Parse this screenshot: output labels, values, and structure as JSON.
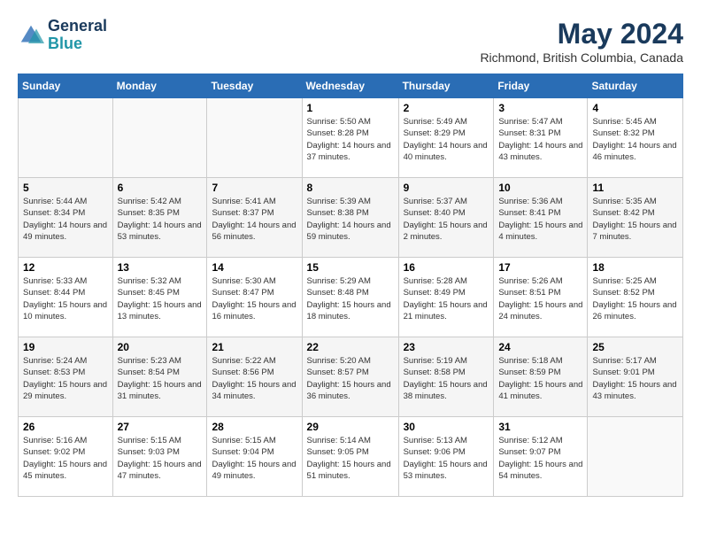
{
  "header": {
    "logo_line1": "General",
    "logo_line2": "Blue",
    "month": "May 2024",
    "location": "Richmond, British Columbia, Canada"
  },
  "days_of_week": [
    "Sunday",
    "Monday",
    "Tuesday",
    "Wednesday",
    "Thursday",
    "Friday",
    "Saturday"
  ],
  "weeks": [
    {
      "days": [
        {
          "num": "",
          "empty": true
        },
        {
          "num": "",
          "empty": true
        },
        {
          "num": "",
          "empty": true
        },
        {
          "num": "1",
          "sunrise": "5:50 AM",
          "sunset": "8:28 PM",
          "daylight": "14 hours and 37 minutes."
        },
        {
          "num": "2",
          "sunrise": "5:49 AM",
          "sunset": "8:29 PM",
          "daylight": "14 hours and 40 minutes."
        },
        {
          "num": "3",
          "sunrise": "5:47 AM",
          "sunset": "8:31 PM",
          "daylight": "14 hours and 43 minutes."
        },
        {
          "num": "4",
          "sunrise": "5:45 AM",
          "sunset": "8:32 PM",
          "daylight": "14 hours and 46 minutes."
        }
      ]
    },
    {
      "days": [
        {
          "num": "5",
          "sunrise": "5:44 AM",
          "sunset": "8:34 PM",
          "daylight": "14 hours and 49 minutes."
        },
        {
          "num": "6",
          "sunrise": "5:42 AM",
          "sunset": "8:35 PM",
          "daylight": "14 hours and 53 minutes."
        },
        {
          "num": "7",
          "sunrise": "5:41 AM",
          "sunset": "8:37 PM",
          "daylight": "14 hours and 56 minutes."
        },
        {
          "num": "8",
          "sunrise": "5:39 AM",
          "sunset": "8:38 PM",
          "daylight": "14 hours and 59 minutes."
        },
        {
          "num": "9",
          "sunrise": "5:37 AM",
          "sunset": "8:40 PM",
          "daylight": "15 hours and 2 minutes."
        },
        {
          "num": "10",
          "sunrise": "5:36 AM",
          "sunset": "8:41 PM",
          "daylight": "15 hours and 4 minutes."
        },
        {
          "num": "11",
          "sunrise": "5:35 AM",
          "sunset": "8:42 PM",
          "daylight": "15 hours and 7 minutes."
        }
      ]
    },
    {
      "days": [
        {
          "num": "12",
          "sunrise": "5:33 AM",
          "sunset": "8:44 PM",
          "daylight": "15 hours and 10 minutes."
        },
        {
          "num": "13",
          "sunrise": "5:32 AM",
          "sunset": "8:45 PM",
          "daylight": "15 hours and 13 minutes."
        },
        {
          "num": "14",
          "sunrise": "5:30 AM",
          "sunset": "8:47 PM",
          "daylight": "15 hours and 16 minutes."
        },
        {
          "num": "15",
          "sunrise": "5:29 AM",
          "sunset": "8:48 PM",
          "daylight": "15 hours and 18 minutes."
        },
        {
          "num": "16",
          "sunrise": "5:28 AM",
          "sunset": "8:49 PM",
          "daylight": "15 hours and 21 minutes."
        },
        {
          "num": "17",
          "sunrise": "5:26 AM",
          "sunset": "8:51 PM",
          "daylight": "15 hours and 24 minutes."
        },
        {
          "num": "18",
          "sunrise": "5:25 AM",
          "sunset": "8:52 PM",
          "daylight": "15 hours and 26 minutes."
        }
      ]
    },
    {
      "days": [
        {
          "num": "19",
          "sunrise": "5:24 AM",
          "sunset": "8:53 PM",
          "daylight": "15 hours and 29 minutes."
        },
        {
          "num": "20",
          "sunrise": "5:23 AM",
          "sunset": "8:54 PM",
          "daylight": "15 hours and 31 minutes."
        },
        {
          "num": "21",
          "sunrise": "5:22 AM",
          "sunset": "8:56 PM",
          "daylight": "15 hours and 34 minutes."
        },
        {
          "num": "22",
          "sunrise": "5:20 AM",
          "sunset": "8:57 PM",
          "daylight": "15 hours and 36 minutes."
        },
        {
          "num": "23",
          "sunrise": "5:19 AM",
          "sunset": "8:58 PM",
          "daylight": "15 hours and 38 minutes."
        },
        {
          "num": "24",
          "sunrise": "5:18 AM",
          "sunset": "8:59 PM",
          "daylight": "15 hours and 41 minutes."
        },
        {
          "num": "25",
          "sunrise": "5:17 AM",
          "sunset": "9:01 PM",
          "daylight": "15 hours and 43 minutes."
        }
      ]
    },
    {
      "days": [
        {
          "num": "26",
          "sunrise": "5:16 AM",
          "sunset": "9:02 PM",
          "daylight": "15 hours and 45 minutes."
        },
        {
          "num": "27",
          "sunrise": "5:15 AM",
          "sunset": "9:03 PM",
          "daylight": "15 hours and 47 minutes."
        },
        {
          "num": "28",
          "sunrise": "5:15 AM",
          "sunset": "9:04 PM",
          "daylight": "15 hours and 49 minutes."
        },
        {
          "num": "29",
          "sunrise": "5:14 AM",
          "sunset": "9:05 PM",
          "daylight": "15 hours and 51 minutes."
        },
        {
          "num": "30",
          "sunrise": "5:13 AM",
          "sunset": "9:06 PM",
          "daylight": "15 hours and 53 minutes."
        },
        {
          "num": "31",
          "sunrise": "5:12 AM",
          "sunset": "9:07 PM",
          "daylight": "15 hours and 54 minutes."
        },
        {
          "num": "",
          "empty": true
        }
      ]
    }
  ]
}
